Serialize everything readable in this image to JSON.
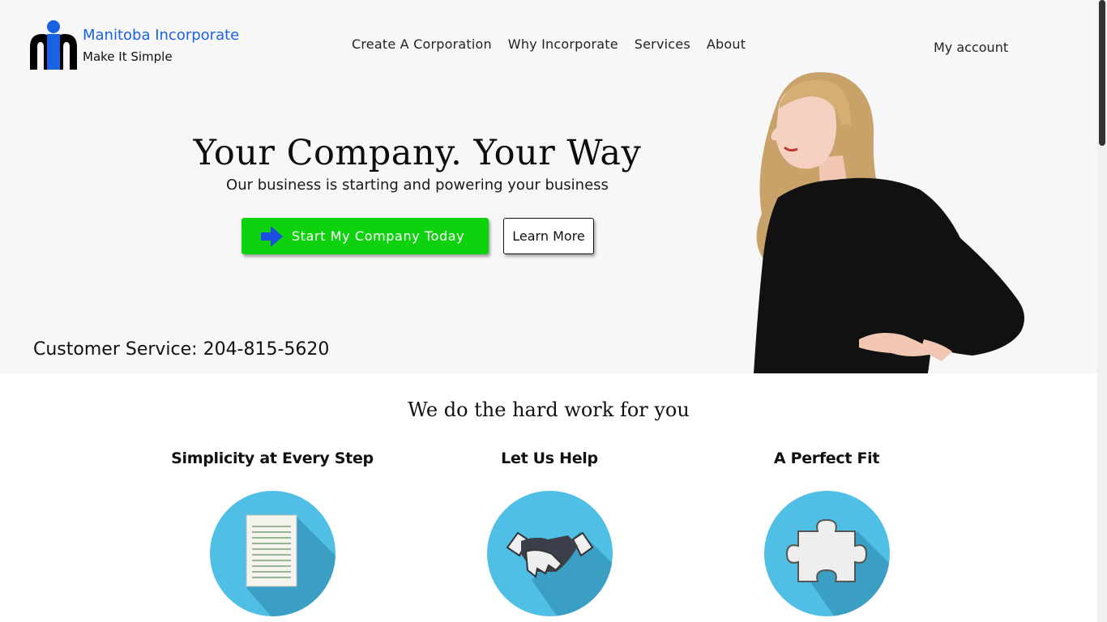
{
  "brand": {
    "name": "Manitoba Incorporate",
    "tagline": "Make It Simple",
    "colors": {
      "accent": "#1a62e0",
      "cta": "#0fd20f",
      "icon_circle": "#4fbfe6"
    }
  },
  "nav": {
    "items": [
      {
        "label": "Create A Corporation"
      },
      {
        "label": "Why Incorporate"
      },
      {
        "label": "Services"
      },
      {
        "label": "About"
      }
    ],
    "account_label": "My account"
  },
  "hero": {
    "title": "Your Company. Your Way",
    "subtitle": "Our business is starting and powering your business",
    "primary_button": {
      "label": "Start My Company Today",
      "icon": "arrow-right-icon"
    },
    "secondary_button": {
      "label": "Learn More"
    },
    "customer_service": "Customer Service: 204-815-5620"
  },
  "features": {
    "title": "We do the hard work for you",
    "items": [
      {
        "title": "Simplicity at Every Step",
        "icon": "document-icon"
      },
      {
        "title": "Let Us Help",
        "icon": "handshake-icon"
      },
      {
        "title": "A Perfect Fit",
        "icon": "puzzle-piece-icon"
      }
    ]
  }
}
